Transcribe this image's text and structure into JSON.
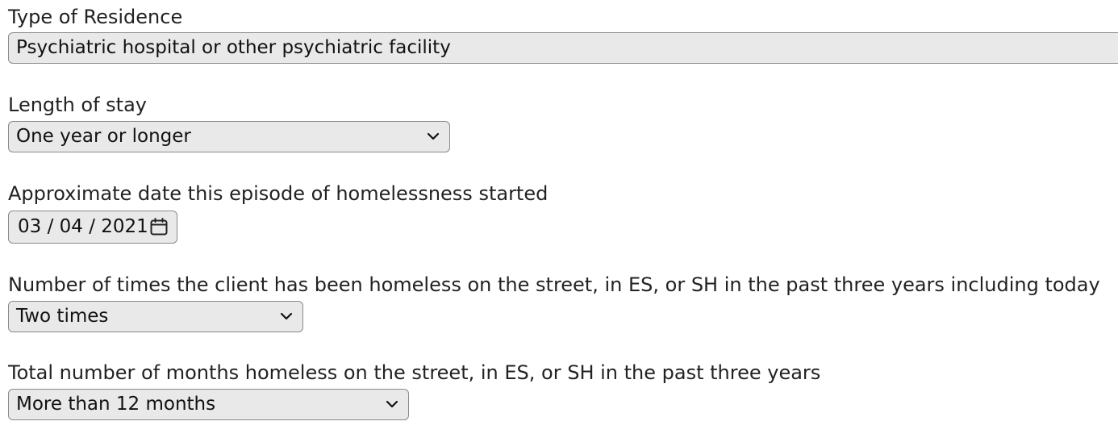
{
  "form": {
    "residence_type": {
      "label": "Type of Residence",
      "value": "Psychiatric hospital or other psychiatric facility"
    },
    "length_of_stay": {
      "label": "Length of stay",
      "value": "One year or longer"
    },
    "homelessness_start": {
      "label": "Approximate date this episode of homelessness started",
      "value": "03 / 04 / 2021"
    },
    "times_homeless": {
      "label": "Number of times the client has been homeless on the street, in ES, or SH in the past three years including today",
      "value": "Two times"
    },
    "months_homeless": {
      "label": "Total number of months homeless on the street, in ES, or SH in the past three years",
      "value": "More than 12 months"
    }
  },
  "icons": {
    "dropdown": "chevron-down-icon",
    "date_picker": "calendar-icon"
  }
}
